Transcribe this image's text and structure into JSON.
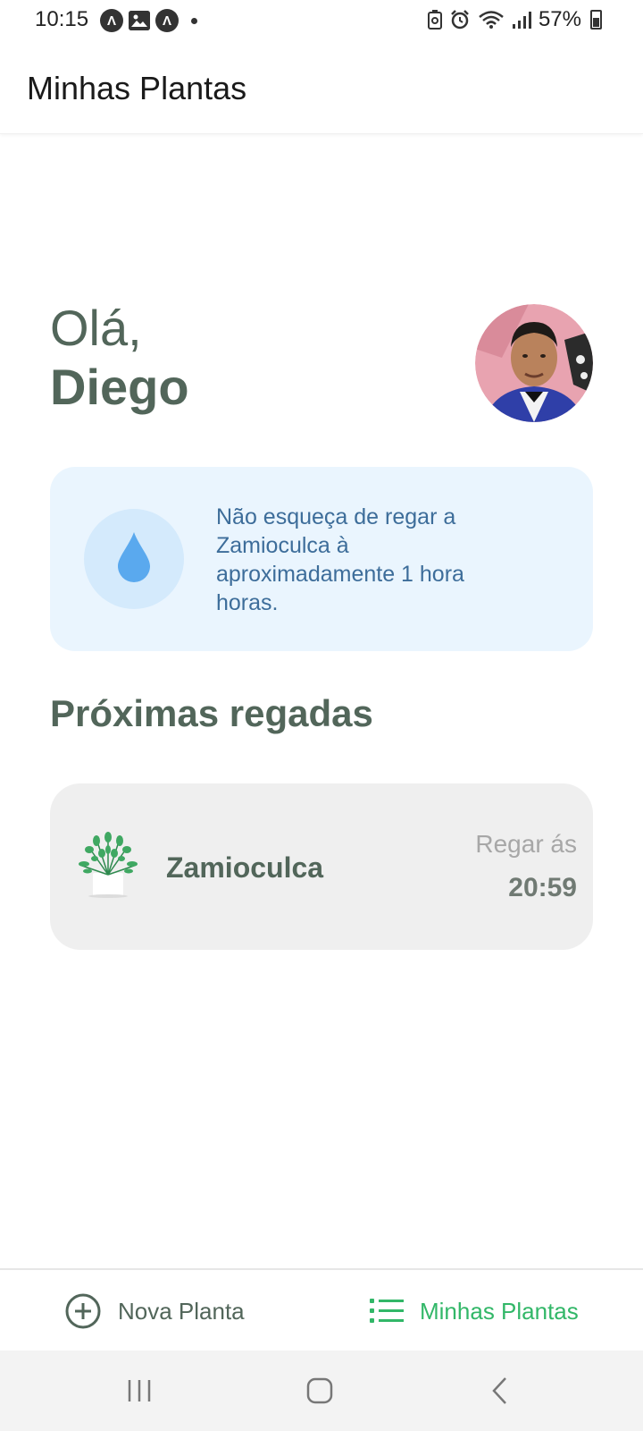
{
  "status_bar": {
    "time": "10:15",
    "battery": "57%",
    "left_icons": [
      "app-a-icon",
      "gallery-icon",
      "app-a-icon",
      "dot-icon"
    ],
    "right_icons": [
      "battery-saver-icon",
      "alarm-icon",
      "wifi-icon",
      "signal-icon",
      "battery-icon"
    ]
  },
  "app_bar": {
    "title": "Minhas Plantas"
  },
  "greeting": {
    "hello": "Olá,",
    "name": "Diego"
  },
  "tip": {
    "text": "Não esqueça de regar a Zamioculca à aproximadamente 1 hora horas.",
    "icon": "water-drop-icon"
  },
  "section": {
    "title": "Próximas regadas"
  },
  "plants": [
    {
      "name": "Zamioculca",
      "when_label": "Regar ás",
      "time": "20:59",
      "icon": "plant-icon"
    }
  ],
  "bottom_tabs": [
    {
      "label": "Nova Planta",
      "icon": "add-circle-icon",
      "active": false
    },
    {
      "label": "Minhas Plantas",
      "icon": "list-icon",
      "active": true
    }
  ],
  "colors": {
    "primary_text": "#52665a",
    "accent_green": "#32b768",
    "tip_background": "#eaf5fe",
    "tip_text": "#3d6d9a",
    "card_background": "#efefef"
  }
}
